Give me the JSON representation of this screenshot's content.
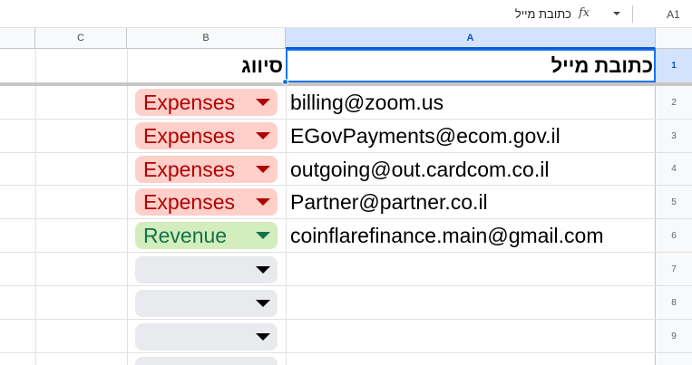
{
  "formula_bar": {
    "cell_ref": "A1",
    "fx_label": "fx",
    "content": "כתובת מייל"
  },
  "columns": [
    {
      "label": "A",
      "selected": true
    },
    {
      "label": "B",
      "selected": false
    },
    {
      "label": "C",
      "selected": false
    }
  ],
  "row_numbers": [
    "1",
    "2",
    "3",
    "4",
    "5",
    "6",
    "7",
    "8",
    "9"
  ],
  "header_row": {
    "email_header": "כתובת מייל",
    "category_header": "סיווג"
  },
  "rows": [
    {
      "email": "billing@zoom.us",
      "category": "Expenses"
    },
    {
      "email": "EGovPayments@ecom.gov.il",
      "category": "Expenses"
    },
    {
      "email": "outgoing@out.cardcom.co.il",
      "category": "Expenses"
    },
    {
      "email": "Partner@partner.co.il",
      "category": "Expenses"
    },
    {
      "email": "coinflarefinance.main@gmail.com",
      "category": "Revenue"
    },
    {
      "email": "",
      "category": ""
    },
    {
      "email": "",
      "category": ""
    },
    {
      "email": "",
      "category": ""
    }
  ],
  "chip_colors": {
    "Expenses": {
      "bg": "#ffcfc9",
      "fg": "#b10202"
    },
    "Revenue": {
      "bg": "#d4edbc",
      "fg": "#11734b"
    },
    "empty": {
      "bg": "#e8eaed",
      "fg": "#000000"
    }
  }
}
